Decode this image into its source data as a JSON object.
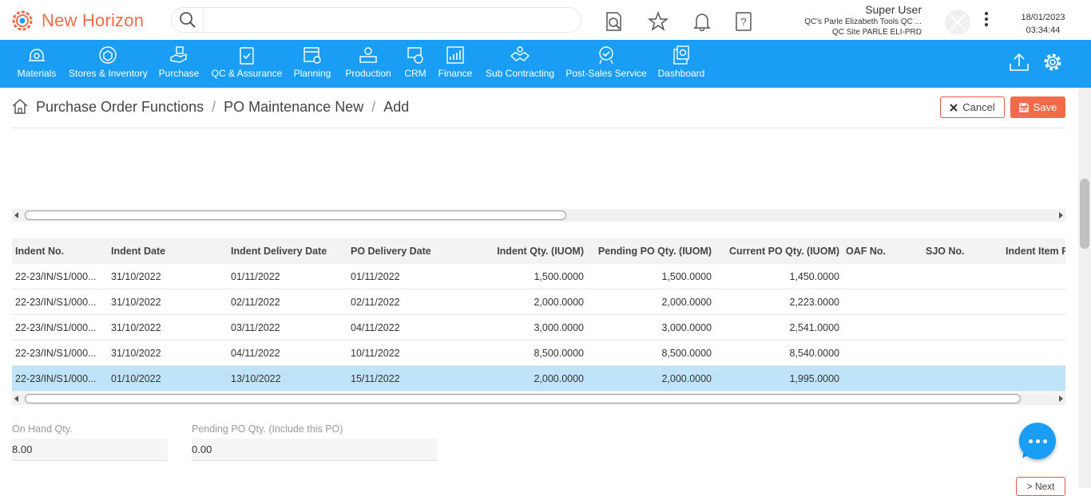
{
  "app": {
    "name": "New Horizon",
    "brand_color": "#f26b4a",
    "nav_color": "#1a9ef5"
  },
  "search": {
    "placeholder": ""
  },
  "user": {
    "name": "Super User",
    "org": "QC's Parle Elizabeth Tools QC ...",
    "site": "QC Site PARLE ELI-PRD"
  },
  "datetime": {
    "date": "18/01/2023",
    "time": "03:34:44"
  },
  "nav": {
    "items": [
      {
        "label": "Materials",
        "icon": "materials-icon"
      },
      {
        "label": "Stores & Inventory",
        "icon": "stores-icon"
      },
      {
        "label": "Purchase",
        "icon": "purchase-icon"
      },
      {
        "label": "QC & Assurance",
        "icon": "qc-icon"
      },
      {
        "label": "Planning",
        "icon": "planning-icon"
      },
      {
        "label": "Production",
        "icon": "production-icon"
      },
      {
        "label": "CRM",
        "icon": "crm-icon"
      },
      {
        "label": "Finance",
        "icon": "finance-icon"
      },
      {
        "label": "Sub Contracting",
        "icon": "subcontracting-icon"
      },
      {
        "label": "Post-Sales Service",
        "icon": "postsales-icon"
      },
      {
        "label": "Dashboard",
        "icon": "dashboard-icon"
      }
    ]
  },
  "breadcrumb": {
    "items": [
      "Purchase Order Functions",
      "PO Maintenance New",
      "Add"
    ],
    "sep": "/"
  },
  "actions": {
    "cancel": "Cancel",
    "save": "Save"
  },
  "grid": {
    "columns": [
      "Indent No.",
      "Indent Date",
      "Indent Delivery Date",
      "PO Delivery Date",
      "Indent Qty. (IUOM)",
      "Pending PO Qty. (IUOM)",
      "Current PO Qty. (IUOM)",
      "OAF No.",
      "SJO No.",
      "Indent Item R"
    ],
    "rows": [
      [
        "22-23/IN/S1/000...",
        "31/10/2022",
        "01/11/2022",
        "01/11/2022",
        "1,500.0000",
        "1,500.0000",
        "1,450.0000",
        "",
        "",
        ""
      ],
      [
        "22-23/IN/S1/000...",
        "31/10/2022",
        "02/11/2022",
        "02/11/2022",
        "2,000.0000",
        "2,000.0000",
        "2,223.0000",
        "",
        "",
        ""
      ],
      [
        "22-23/IN/S1/000...",
        "31/10/2022",
        "03/11/2022",
        "04/11/2022",
        "3,000.0000",
        "3,000.0000",
        "2,541.0000",
        "",
        "",
        ""
      ],
      [
        "22-23/IN/S1/000...",
        "31/10/2022",
        "04/11/2022",
        "10/11/2022",
        "8,500.0000",
        "8,500.0000",
        "8,540.0000",
        "",
        "",
        ""
      ],
      [
        "22-23/IN/S1/000...",
        "01/10/2022",
        "13/10/2022",
        "15/11/2022",
        "2,000.0000",
        "2,000.0000",
        "1,995.0000",
        "",
        "",
        ""
      ]
    ],
    "selected_row": 4
  },
  "fields": {
    "on_hand": {
      "label": "On Hand Qty.",
      "value": "8.00"
    },
    "pending_po": {
      "label": "Pending PO Qty. (Include this PO)",
      "value": "0.00"
    }
  },
  "footer": {
    "next": "> Next"
  }
}
